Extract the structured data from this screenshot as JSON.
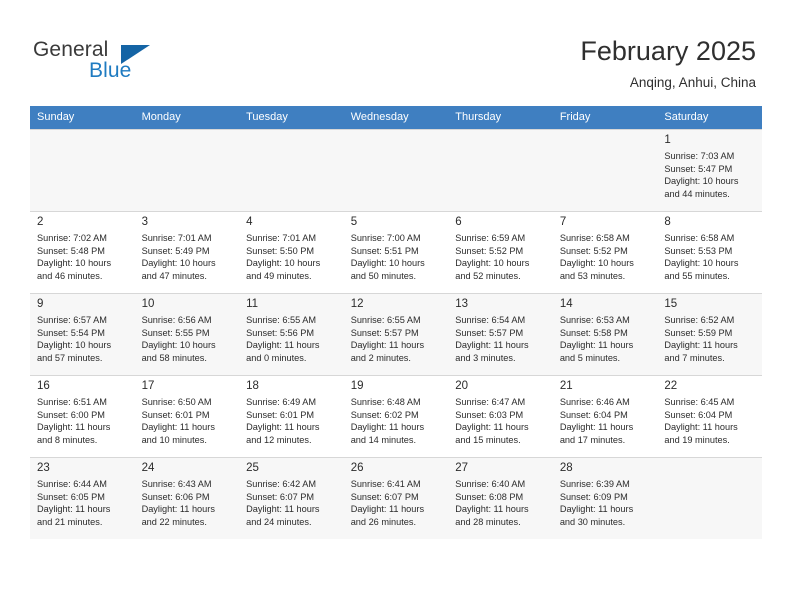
{
  "brand": {
    "name_part1": "General",
    "name_part2": "Blue",
    "logo_icon": "blue-triangle-icon"
  },
  "header": {
    "month_title": "February 2025",
    "location": "Anqing, Anhui, China"
  },
  "weekday_headers": [
    "Sunday",
    "Monday",
    "Tuesday",
    "Wednesday",
    "Thursday",
    "Friday",
    "Saturday"
  ],
  "labels": {
    "sunrise_prefix": "Sunrise:",
    "sunset_prefix": "Sunset:",
    "daylight_prefix": "Daylight:"
  },
  "colors": {
    "header_blue": "#3f7fc1",
    "brand_blue": "#1f7bc1",
    "logo_blue": "#1464a5",
    "row_shade": "#f7f7f7",
    "cell_border": "#d7d7d7"
  },
  "weeks": [
    [
      {
        "empty": true
      },
      {
        "empty": true
      },
      {
        "empty": true
      },
      {
        "empty": true
      },
      {
        "empty": true
      },
      {
        "empty": true
      },
      {
        "day": "1",
        "sunrise": "Sunrise: 7:03 AM",
        "sunset": "Sunset: 5:47 PM",
        "daylight_l1": "Daylight: 10 hours",
        "daylight_l2": "and 44 minutes."
      }
    ],
    [
      {
        "day": "2",
        "sunrise": "Sunrise: 7:02 AM",
        "sunset": "Sunset: 5:48 PM",
        "daylight_l1": "Daylight: 10 hours",
        "daylight_l2": "and 46 minutes."
      },
      {
        "day": "3",
        "sunrise": "Sunrise: 7:01 AM",
        "sunset": "Sunset: 5:49 PM",
        "daylight_l1": "Daylight: 10 hours",
        "daylight_l2": "and 47 minutes."
      },
      {
        "day": "4",
        "sunrise": "Sunrise: 7:01 AM",
        "sunset": "Sunset: 5:50 PM",
        "daylight_l1": "Daylight: 10 hours",
        "daylight_l2": "and 49 minutes."
      },
      {
        "day": "5",
        "sunrise": "Sunrise: 7:00 AM",
        "sunset": "Sunset: 5:51 PM",
        "daylight_l1": "Daylight: 10 hours",
        "daylight_l2": "and 50 minutes."
      },
      {
        "day": "6",
        "sunrise": "Sunrise: 6:59 AM",
        "sunset": "Sunset: 5:52 PM",
        "daylight_l1": "Daylight: 10 hours",
        "daylight_l2": "and 52 minutes."
      },
      {
        "day": "7",
        "sunrise": "Sunrise: 6:58 AM",
        "sunset": "Sunset: 5:52 PM",
        "daylight_l1": "Daylight: 10 hours",
        "daylight_l2": "and 53 minutes."
      },
      {
        "day": "8",
        "sunrise": "Sunrise: 6:58 AM",
        "sunset": "Sunset: 5:53 PM",
        "daylight_l1": "Daylight: 10 hours",
        "daylight_l2": "and 55 minutes."
      }
    ],
    [
      {
        "day": "9",
        "sunrise": "Sunrise: 6:57 AM",
        "sunset": "Sunset: 5:54 PM",
        "daylight_l1": "Daylight: 10 hours",
        "daylight_l2": "and 57 minutes."
      },
      {
        "day": "10",
        "sunrise": "Sunrise: 6:56 AM",
        "sunset": "Sunset: 5:55 PM",
        "daylight_l1": "Daylight: 10 hours",
        "daylight_l2": "and 58 minutes."
      },
      {
        "day": "11",
        "sunrise": "Sunrise: 6:55 AM",
        "sunset": "Sunset: 5:56 PM",
        "daylight_l1": "Daylight: 11 hours",
        "daylight_l2": "and 0 minutes."
      },
      {
        "day": "12",
        "sunrise": "Sunrise: 6:55 AM",
        "sunset": "Sunset: 5:57 PM",
        "daylight_l1": "Daylight: 11 hours",
        "daylight_l2": "and 2 minutes."
      },
      {
        "day": "13",
        "sunrise": "Sunrise: 6:54 AM",
        "sunset": "Sunset: 5:57 PM",
        "daylight_l1": "Daylight: 11 hours",
        "daylight_l2": "and 3 minutes."
      },
      {
        "day": "14",
        "sunrise": "Sunrise: 6:53 AM",
        "sunset": "Sunset: 5:58 PM",
        "daylight_l1": "Daylight: 11 hours",
        "daylight_l2": "and 5 minutes."
      },
      {
        "day": "15",
        "sunrise": "Sunrise: 6:52 AM",
        "sunset": "Sunset: 5:59 PM",
        "daylight_l1": "Daylight: 11 hours",
        "daylight_l2": "and 7 minutes."
      }
    ],
    [
      {
        "day": "16",
        "sunrise": "Sunrise: 6:51 AM",
        "sunset": "Sunset: 6:00 PM",
        "daylight_l1": "Daylight: 11 hours",
        "daylight_l2": "and 8 minutes."
      },
      {
        "day": "17",
        "sunrise": "Sunrise: 6:50 AM",
        "sunset": "Sunset: 6:01 PM",
        "daylight_l1": "Daylight: 11 hours",
        "daylight_l2": "and 10 minutes."
      },
      {
        "day": "18",
        "sunrise": "Sunrise: 6:49 AM",
        "sunset": "Sunset: 6:01 PM",
        "daylight_l1": "Daylight: 11 hours",
        "daylight_l2": "and 12 minutes."
      },
      {
        "day": "19",
        "sunrise": "Sunrise: 6:48 AM",
        "sunset": "Sunset: 6:02 PM",
        "daylight_l1": "Daylight: 11 hours",
        "daylight_l2": "and 14 minutes."
      },
      {
        "day": "20",
        "sunrise": "Sunrise: 6:47 AM",
        "sunset": "Sunset: 6:03 PM",
        "daylight_l1": "Daylight: 11 hours",
        "daylight_l2": "and 15 minutes."
      },
      {
        "day": "21",
        "sunrise": "Sunrise: 6:46 AM",
        "sunset": "Sunset: 6:04 PM",
        "daylight_l1": "Daylight: 11 hours",
        "daylight_l2": "and 17 minutes."
      },
      {
        "day": "22",
        "sunrise": "Sunrise: 6:45 AM",
        "sunset": "Sunset: 6:04 PM",
        "daylight_l1": "Daylight: 11 hours",
        "daylight_l2": "and 19 minutes."
      }
    ],
    [
      {
        "day": "23",
        "sunrise": "Sunrise: 6:44 AM",
        "sunset": "Sunset: 6:05 PM",
        "daylight_l1": "Daylight: 11 hours",
        "daylight_l2": "and 21 minutes."
      },
      {
        "day": "24",
        "sunrise": "Sunrise: 6:43 AM",
        "sunset": "Sunset: 6:06 PM",
        "daylight_l1": "Daylight: 11 hours",
        "daylight_l2": "and 22 minutes."
      },
      {
        "day": "25",
        "sunrise": "Sunrise: 6:42 AM",
        "sunset": "Sunset: 6:07 PM",
        "daylight_l1": "Daylight: 11 hours",
        "daylight_l2": "and 24 minutes."
      },
      {
        "day": "26",
        "sunrise": "Sunrise: 6:41 AM",
        "sunset": "Sunset: 6:07 PM",
        "daylight_l1": "Daylight: 11 hours",
        "daylight_l2": "and 26 minutes."
      },
      {
        "day": "27",
        "sunrise": "Sunrise: 6:40 AM",
        "sunset": "Sunset: 6:08 PM",
        "daylight_l1": "Daylight: 11 hours",
        "daylight_l2": "and 28 minutes."
      },
      {
        "day": "28",
        "sunrise": "Sunrise: 6:39 AM",
        "sunset": "Sunset: 6:09 PM",
        "daylight_l1": "Daylight: 11 hours",
        "daylight_l2": "and 30 minutes."
      },
      {
        "empty": true
      }
    ]
  ]
}
